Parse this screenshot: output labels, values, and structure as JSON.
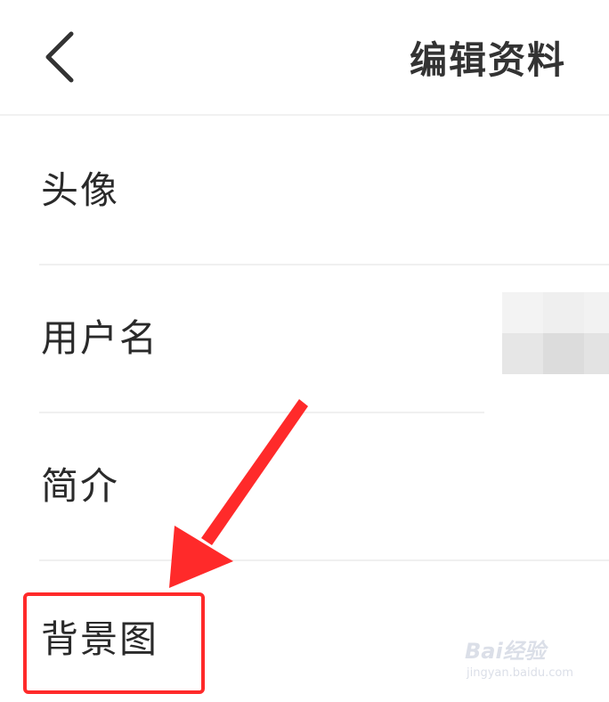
{
  "header": {
    "back_icon": "chevron-left-icon",
    "title": "编辑资料"
  },
  "rows": [
    {
      "label": "头像"
    },
    {
      "label": "用户名"
    },
    {
      "label": "简介"
    },
    {
      "label": "背景图"
    }
  ],
  "annotation": {
    "highlight_color": "#ff2a2a",
    "arrow_color": "#ff2a2a"
  },
  "watermark": {
    "logo_text": "Bai经验",
    "url": "jingyan.baidu.com"
  }
}
